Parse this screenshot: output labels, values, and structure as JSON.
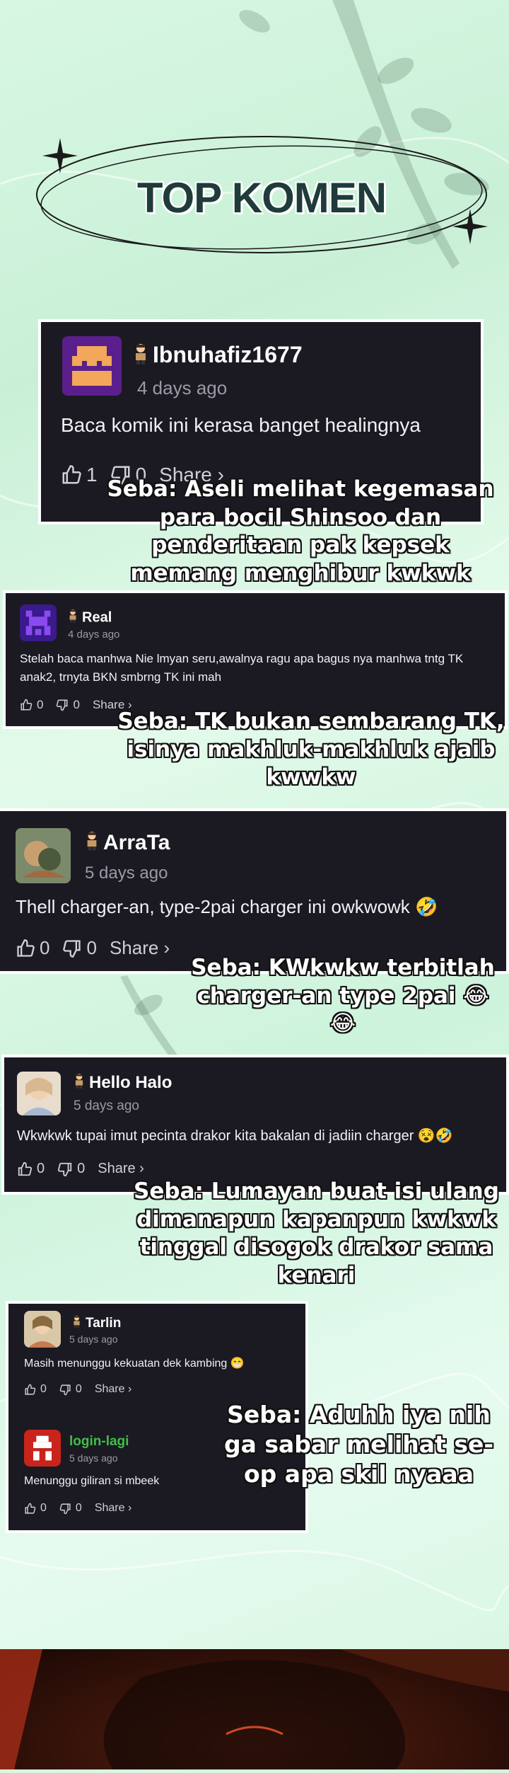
{
  "colors": {
    "card_bg": "#1b1a22",
    "bg_mint": "#d8f7e3",
    "title": "#1f3b3a",
    "green_name": "#3fbf4a"
  },
  "header": {
    "title": "TOP KOMEN"
  },
  "comments": [
    {
      "username": "Ibnuhafiz1677",
      "time": "4 days ago",
      "text": "Baca komik ini kerasa banget healingnya",
      "likes": "1",
      "dislikes": "0",
      "share": "Share ›",
      "reply": "Seba: Aseli melihat kegemasan para bocil Shinsoo dan penderitaan pak kepsek memang menghibur kwkwk"
    },
    {
      "username": "Real",
      "time": "4 days ago",
      "text": "Stelah baca manhwa Nie lmyan seru,awalnya ragu apa bagus nya manhwa tntg TK anak2, trnyta BKN smbrng TK ini mah",
      "likes": "0",
      "dislikes": "0",
      "share": "Share ›",
      "reply": "Seba: TK bukan sembarang TK, isinya makhluk-makhluk ajaib kwwkw"
    },
    {
      "username": "ArraTa",
      "time": "5 days ago",
      "text": "Thell charger-an, type-2pai charger ini owkwowk 🤣",
      "likes": "0",
      "dislikes": "0",
      "share": "Share ›",
      "reply": "Seba: KWkwkw terbitlah charger-an type 2pai 😂😂"
    },
    {
      "username": "Hello Halo",
      "time": "5 days ago",
      "text": "Wkwkwk tupai imut pecinta drakor kita bakalan di jadiin charger 😵🤣",
      "likes": "0",
      "dislikes": "0",
      "share": "Share ›",
      "reply": "Seba: Lumayan buat isi ulang dimanapun kapanpun kwkwk tinggal disogok drakor sama kenari"
    },
    {
      "username": "Tarlin",
      "time": "5 days ago",
      "text": "Masih menunggu kekuatan dek kambing 😁",
      "likes": "0",
      "dislikes": "0",
      "share": "Share ›"
    },
    {
      "username": "login-lagi",
      "time": "5 days ago",
      "text": "Menunggu giliran si mbeek",
      "likes": "0",
      "dislikes": "0",
      "share": "Share ›",
      "reply": "Seba: Aduhh iya nih ga sabar melihat se-op apa skil nyaaa"
    }
  ]
}
